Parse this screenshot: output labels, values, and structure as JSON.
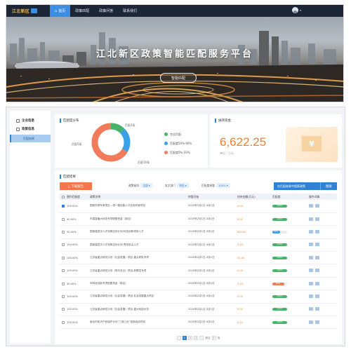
{
  "header": {
    "logo_text": "江北新区",
    "nav": [
      "首页",
      "政策匹配",
      "政策问答",
      "联系我们"
    ],
    "home_icon": "home-icon",
    "avatar_icon": "user-avatar-icon"
  },
  "banner": {
    "title": "江北新区政策智能匹配服务平台",
    "button": "智能匹配"
  },
  "sidebar": {
    "items": [
      {
        "label": "企业信息",
        "icon": "building-icon"
      },
      {
        "label": "政策信息",
        "icon": "document-icon"
      }
    ],
    "sub_item": "匹配结果"
  },
  "distribution": {
    "title": "匹配度分布",
    "labels": {
      "full": "匹配3条",
      "high": "匹配16条",
      "mid": "匹配5条"
    },
    "legend": [
      "完全匹配",
      "匹配度50%-90%",
      "匹配度0%-50%"
    ],
    "colors": [
      "#47b36b",
      "#3aa0e8",
      "#f27b5c"
    ]
  },
  "chart_data": {
    "type": "pie",
    "categories": [
      "完全匹配",
      "匹配度50%-90%",
      "匹配度0%-50%"
    ],
    "values": [
      3,
      5,
      16
    ]
  },
  "funding": {
    "title": "扶持资金",
    "value": "6,622.25",
    "unit": "单位：万元",
    "icon": "money-bill-icon"
  },
  "results": {
    "title": "匹配结果",
    "download": "下载报告",
    "filters": [
      {
        "label": "政策级别",
        "value": "全部"
      },
      {
        "label": "发文部门",
        "value": "科技"
      },
      {
        "label": "匹配度调整",
        "value": "100%"
      }
    ],
    "search_placeholder": "在匹配结果中搜索政策",
    "search_button": "搜索",
    "columns": [
      "营利匹配度",
      "政策名称",
      "申报开始",
      "扶持金额(万元)",
      "匹配度",
      "操作详情"
    ],
    "rows": [
      {
        "checked": true,
        "pct": "100.00%",
        "name": "国家外贸专家项目—带一路技能人才实用专家项目",
        "date": "2020年2月1日-3月1日",
        "amount": "0.00",
        "deg": 100,
        "deg_label": "100%",
        "deg_color": "#47b36b"
      },
      {
        "checked": false,
        "pct": "90.00%",
        "name": "市直接播大科技专项配额资金（新目）",
        "date": "2020年2月1日-3月1日",
        "amount": "0.00",
        "deg": 100,
        "deg_label": "100%",
        "deg_color": "#47b36b"
      },
      {
        "checked": false,
        "pct": "50.00%",
        "name": "国家高层次人才特殊支持计划 科技创新领军人才",
        "date": "2020年2月1日-3月1日",
        "amount": "800.00",
        "deg": 50,
        "deg_label": "50%",
        "deg_color": "#3aa0e8"
      },
      {
        "checked": false,
        "pct": "100.00%",
        "name": "国家高层次人才特殊支持计划 青年拔尖人才",
        "date": "2020年2月1日-3月1日",
        "amount": "0.00",
        "deg": 100,
        "deg_label": "100%",
        "deg_color": "#47b36b"
      },
      {
        "checked": false,
        "pct": "100.00%",
        "name": "江苏省重点研发计划（社会发展）项目-重点研发专项",
        "date": "2020年2月1日-3月1日",
        "amount": "20.00",
        "deg": 100,
        "deg_label": "100%",
        "deg_color": "#47b36b"
      },
      {
        "checked": false,
        "pct": "100.00%",
        "name": "江苏省重点研发计划（现代农业）项目-前瞻性专项",
        "date": "2020年2月1日-3月1日",
        "amount": "0.00",
        "deg": 100,
        "deg_label": "100%",
        "deg_color": "#47b36b"
      },
      {
        "checked": false,
        "pct": "30.00%",
        "name": "市科技创新专项配额资金（新目）",
        "date": "2020年2月1日-3月1日",
        "amount": "0.00",
        "deg": 80,
        "deg_label": "80%",
        "deg_color": "#f27b5c"
      },
      {
        "checked": false,
        "pct": "100.00%",
        "name": "江苏省重点研发计划（社会发展）项目-社会发展重点项目",
        "date": "2020年2月1日-3月1日",
        "amount": "0.00",
        "deg": 100,
        "deg_label": "100%",
        "deg_color": "#47b36b"
      },
      {
        "checked": false,
        "pct": "100.00%",
        "name": "江苏省重点研发计划（社会发展）项目-重大科技示范",
        "date": "2020年2月1日-3月1日",
        "amount": "0.00",
        "deg": 100,
        "deg_label": "100%",
        "deg_color": "#47b36b"
      },
      {
        "checked": false,
        "pct": "100.00%",
        "name": "南京市知识产权保护计划“三强三优”奖励培训项目",
        "date": "2020年2月1日-3月1日",
        "amount": "0.00",
        "deg": 100,
        "deg_label": "100%",
        "deg_color": "#47b36b"
      }
    ],
    "pager": {
      "prev": "‹",
      "pages": [
        "1",
        "2",
        "3"
      ],
      "next": "›",
      "goto": "前往",
      "page_input": "1",
      "unit": "页"
    }
  }
}
